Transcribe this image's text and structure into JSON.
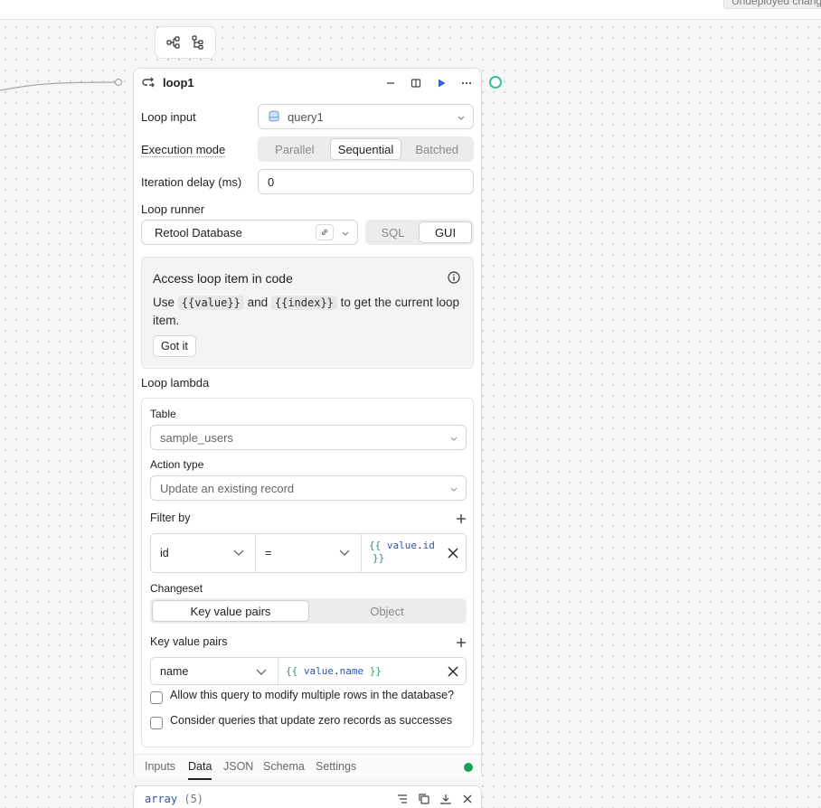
{
  "topbar": {
    "badge": "Undeployed changes"
  },
  "block": {
    "title": "loop1",
    "loop_input": {
      "label": "Loop input",
      "value": "query1"
    },
    "execution_mode": {
      "label": "Execution mode",
      "options": [
        "Parallel",
        "Sequential",
        "Batched"
      ],
      "selected": "Sequential"
    },
    "iteration_delay": {
      "label": "Iteration delay (ms)",
      "value": "0"
    },
    "loop_runner": {
      "label": "Loop runner",
      "resource": "Retool Database",
      "modes": [
        "SQL",
        "GUI"
      ],
      "selected_mode": "GUI"
    },
    "info": {
      "title": "Access loop item in code",
      "text_prefix": "Use",
      "chip1": "{{value}}",
      "text_mid": "and",
      "chip2": "{{index}}",
      "text_suffix": "to get the current loop item.",
      "button": "Got it"
    },
    "lambda": {
      "label": "Loop lambda",
      "table": {
        "label": "Table",
        "value": "sample_users"
      },
      "action_type": {
        "label": "Action type",
        "value": "Update an existing record"
      },
      "filter_by": {
        "label": "Filter by",
        "column": "id",
        "operator": "=",
        "value_open": "{{",
        "value_var": "value",
        "value_dot": ".",
        "value_prop": "id",
        "value_close": "}}"
      },
      "changeset": {
        "label": "Changeset",
        "options": [
          "Key value pairs",
          "Object"
        ],
        "selected": "Key value pairs"
      },
      "kv": {
        "label": "Key value pairs",
        "key": "name",
        "value_open": "{{",
        "value_var": "value",
        "value_dot": ".",
        "value_prop": "name",
        "value_close": "}}"
      },
      "checks": [
        "Allow this query to modify multiple rows in the database?",
        "Consider queries that update zero records as successes"
      ]
    },
    "tabs": [
      "Inputs",
      "Data",
      "JSON",
      "Schema",
      "Settings"
    ],
    "active_tab": "Data"
  },
  "result": {
    "type": "array",
    "count": "(5)"
  },
  "colors": {
    "accent": "#2563eb",
    "success": "#1aa05b",
    "port": "#3bbf86"
  }
}
